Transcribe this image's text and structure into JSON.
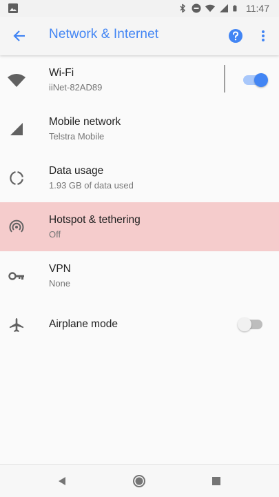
{
  "status_bar": {
    "time": "11:47",
    "left_icon": "image-icon",
    "icons": [
      "bluetooth-icon",
      "dnd-icon",
      "wifi-icon",
      "cell-signal-icon",
      "battery-icon"
    ]
  },
  "app_bar": {
    "title": "Network & Internet",
    "back_icon": "arrow-back-icon",
    "help_icon": "help-icon",
    "more_icon": "more-vert-icon",
    "accent_color": "#4285f4"
  },
  "settings": [
    {
      "title": "Wi-Fi",
      "subtitle": "iiNet-82AD89",
      "icon": "wifi-icon",
      "toggle": true
    },
    {
      "title": "Mobile network",
      "subtitle": "Telstra Mobile",
      "icon": "cell-signal-icon"
    },
    {
      "title": "Data usage",
      "subtitle": "1.93 GB of data used",
      "icon": "data-usage-icon"
    },
    {
      "title": "Hotspot & tethering",
      "subtitle": "Off",
      "icon": "hotspot-icon",
      "highlighted": true
    },
    {
      "title": "VPN",
      "subtitle": "None",
      "icon": "vpn-key-icon"
    },
    {
      "title": "Airplane mode",
      "icon": "airplane-icon",
      "toggle": false
    }
  ],
  "nav_bar": {
    "icons": [
      "back-triangle-icon",
      "home-circle-icon",
      "recents-square-icon"
    ]
  },
  "colors": {
    "highlight": "#f5cccc",
    "toggle_on": "#4285f4",
    "toggle_off": "#bdbdbd"
  }
}
